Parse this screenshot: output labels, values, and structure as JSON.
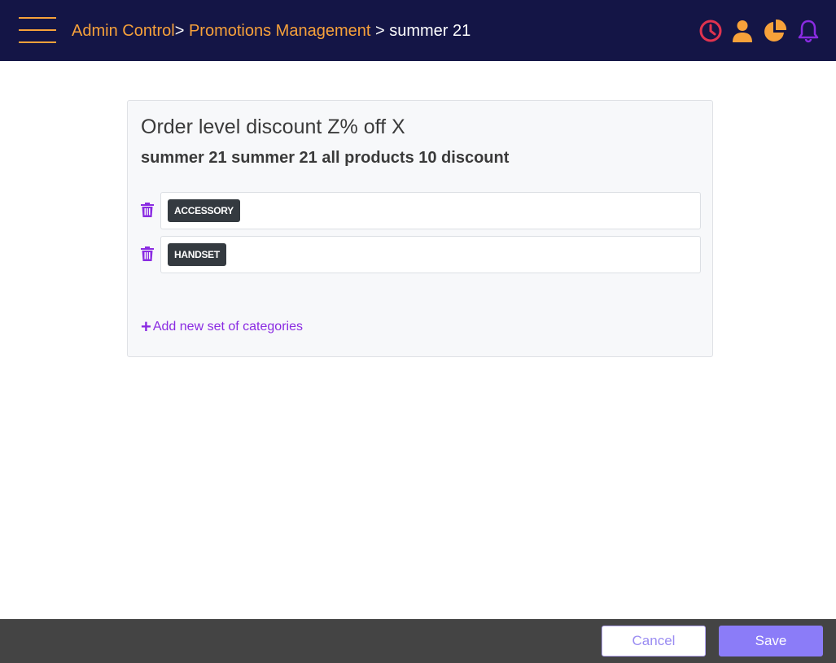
{
  "header": {
    "breadcrumb": {
      "level1": "Admin Control",
      "sep1": ">",
      "level2": "Promotions Management",
      "sep2": " > ",
      "current": "summer 21"
    },
    "icons": [
      {
        "name": "clock-icon",
        "color": "#e0334f"
      },
      {
        "name": "user-icon",
        "color": "#f7a13a"
      },
      {
        "name": "pie-chart-icon",
        "color": "#f7a13a"
      },
      {
        "name": "bell-icon",
        "color": "#8a2be2"
      }
    ]
  },
  "card": {
    "title": "Order level discount Z% off X",
    "subtitle": "summer 21 summer 21 all products 10 discount",
    "categories": [
      {
        "tag": "ACCESSORY"
      },
      {
        "tag": "HANDSET"
      }
    ],
    "add_label": "Add new set of categories"
  },
  "footer": {
    "cancel_label": "Cancel",
    "save_label": "Save"
  },
  "colors": {
    "header_bg": "#141546",
    "accent_orange": "#f7a13a",
    "accent_purple": "#8a2be2",
    "save_button": "#8b7cf8",
    "footer_bg": "#444444"
  }
}
